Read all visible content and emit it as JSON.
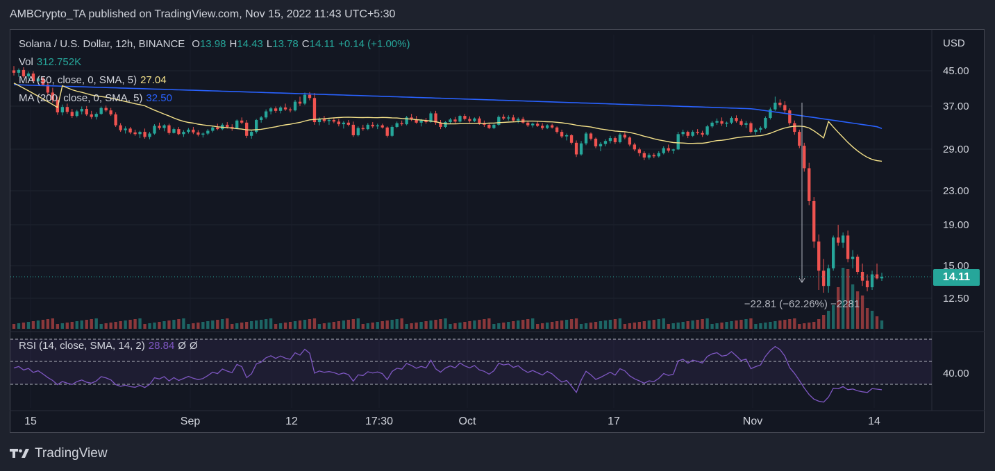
{
  "header": {
    "published": "AMBCrypto_TA published on TradingView.com, Nov 15, 2022 11:43 UTC+5:30"
  },
  "legend": {
    "symbol": "Solana / U.S. Dollar, 12h, BINANCE",
    "o_label": "O",
    "o": "13.98",
    "h_label": "H",
    "h": "14.43",
    "l_label": "L",
    "l": "13.78",
    "c_label": "C",
    "c": "14.11",
    "change": "+0.14 (+1.00%)",
    "vol_label": "Vol",
    "vol": "312.752K",
    "ma50_label": "MA (50, close, 0, SMA, 5)",
    "ma50": "27.04",
    "ma200_label": "MA (200, close, 0, SMA, 5)",
    "ma200": "32.50",
    "rsi_label": "RSI (14, close, SMA, 14, 2)",
    "rsi": "28.84",
    "rsi_extra1": "Ø",
    "rsi_extra2": "Ø"
  },
  "price_axis": {
    "currency": "USD",
    "ticks": [
      "45.00",
      "37.00",
      "29.00",
      "23.00",
      "19.00",
      "15.00",
      "12.50"
    ],
    "last_price": "14.11"
  },
  "rsi_axis": {
    "ticks": [
      "40.00"
    ]
  },
  "time_axis": {
    "ticks": [
      "15",
      "Sep",
      "12",
      "17:30",
      "Oct",
      "17",
      "Nov",
      "14"
    ]
  },
  "measure": {
    "label": "−22.81 (−62.26%) −2281"
  },
  "footer": {
    "brand": "TradingView"
  },
  "colors": {
    "up": "#26a69a",
    "down": "#ef5350",
    "ma50": "#f5e28a",
    "ma200": "#2962ff",
    "rsi": "#7e57c2",
    "background": "#131722"
  },
  "chart_data": {
    "type": "candlestick",
    "timeframe": "12h",
    "price_scale": "log",
    "ylim": [
      11.5,
      50
    ],
    "rsi_ylim": [
      0,
      100
    ],
    "rsi_bands": [
      70,
      50,
      30
    ],
    "candles": [
      [
        45.1,
        46.2,
        43.8,
        44.5
      ],
      [
        44.5,
        45.6,
        43.5,
        45.2
      ],
      [
        45.2,
        45.9,
        43.2,
        43.6
      ],
      [
        43.6,
        44.8,
        42.9,
        44.3
      ],
      [
        44.3,
        44.9,
        42.1,
        42.4
      ],
      [
        42.4,
        43.5,
        41.9,
        43.1
      ],
      [
        43.1,
        43.6,
        41.3,
        41.6
      ],
      [
        41.6,
        42.3,
        39.2,
        39.8
      ],
      [
        39.8,
        40.9,
        37.6,
        38.2
      ],
      [
        38.2,
        38.9,
        35.1,
        35.6
      ],
      [
        35.6,
        37.2,
        35.0,
        36.7
      ],
      [
        36.7,
        37.4,
        35.3,
        35.7
      ],
      [
        35.7,
        36.3,
        34.5,
        34.9
      ],
      [
        34.9,
        36.1,
        34.6,
        35.8
      ],
      [
        35.8,
        36.8,
        35.2,
        36.3
      ],
      [
        36.3,
        36.9,
        34.9,
        35.2
      ],
      [
        35.2,
        35.9,
        34.3,
        34.7
      ],
      [
        34.7,
        35.6,
        34.2,
        35.3
      ],
      [
        35.3,
        36.8,
        35.1,
        36.5
      ],
      [
        36.5,
        37.0,
        35.7,
        36.0
      ],
      [
        36.0,
        36.5,
        34.9,
        35.2
      ],
      [
        35.2,
        35.6,
        32.8,
        33.1
      ],
      [
        33.1,
        33.5,
        31.9,
        32.2
      ],
      [
        32.2,
        32.9,
        31.6,
        32.5
      ],
      [
        32.5,
        32.8,
        31.5,
        31.8
      ],
      [
        31.8,
        32.3,
        31.2,
        31.5
      ],
      [
        31.5,
        32.1,
        30.8,
        31.9
      ],
      [
        31.9,
        32.5,
        30.7,
        31.0
      ],
      [
        31.0,
        31.9,
        30.6,
        31.6
      ],
      [
        31.6,
        33.3,
        31.4,
        33.0
      ],
      [
        33.0,
        33.6,
        32.3,
        32.6
      ],
      [
        32.6,
        33.3,
        32.0,
        33.1
      ],
      [
        33.1,
        33.4,
        31.4,
        31.7
      ],
      [
        31.7,
        32.7,
        31.6,
        32.4
      ],
      [
        32.4,
        32.8,
        31.3,
        31.5
      ],
      [
        31.5,
        32.2,
        31.0,
        31.9
      ],
      [
        31.9,
        32.6,
        31.6,
        32.3
      ],
      [
        32.3,
        32.8,
        31.5,
        31.8
      ],
      [
        31.8,
        32.2,
        31.1,
        31.4
      ],
      [
        31.4,
        31.8,
        30.9,
        31.6
      ],
      [
        31.6,
        32.4,
        31.3,
        32.1
      ],
      [
        32.1,
        32.9,
        31.8,
        32.7
      ],
      [
        32.7,
        33.4,
        32.2,
        32.4
      ],
      [
        32.4,
        33.5,
        32.2,
        33.2
      ],
      [
        33.2,
        33.7,
        32.5,
        32.8
      ],
      [
        32.8,
        33.3,
        32.1,
        32.5
      ],
      [
        32.5,
        34.2,
        32.4,
        34.0
      ],
      [
        34.0,
        34.6,
        33.3,
        33.6
      ],
      [
        33.6,
        34.1,
        30.8,
        31.2
      ],
      [
        31.2,
        32.1,
        30.7,
        31.9
      ],
      [
        31.9,
        34.3,
        31.6,
        34.1
      ],
      [
        34.1,
        34.9,
        33.6,
        34.6
      ],
      [
        34.6,
        36.2,
        34.3,
        35.8
      ],
      [
        35.8,
        36.7,
        35.2,
        36.4
      ],
      [
        36.4,
        36.8,
        35.5,
        35.9
      ],
      [
        35.9,
        36.9,
        35.4,
        36.6
      ],
      [
        36.6,
        37.4,
        35.9,
        36.2
      ],
      [
        36.2,
        36.6,
        35.6,
        36.0
      ],
      [
        36.0,
        38.2,
        35.8,
        37.8
      ],
      [
        37.8,
        38.9,
        36.9,
        37.4
      ],
      [
        37.4,
        39.8,
        37.1,
        39.3
      ],
      [
        39.3,
        39.9,
        38.1,
        38.6
      ],
      [
        38.6,
        39.7,
        33.2,
        33.7
      ],
      [
        33.7,
        34.6,
        33.1,
        34.3
      ],
      [
        34.3,
        34.9,
        33.6,
        33.9
      ],
      [
        33.9,
        34.5,
        33.2,
        34.1
      ],
      [
        34.1,
        34.6,
        33.5,
        33.8
      ],
      [
        33.8,
        34.3,
        32.9,
        33.3
      ],
      [
        33.3,
        33.9,
        32.5,
        33.6
      ],
      [
        33.6,
        34.1,
        32.9,
        33.2
      ],
      [
        33.2,
        33.8,
        31.0,
        31.3
      ],
      [
        31.3,
        32.9,
        31.1,
        32.6
      ],
      [
        32.6,
        33.2,
        32.1,
        32.4
      ],
      [
        32.4,
        33.5,
        32.2,
        33.2
      ],
      [
        33.2,
        33.7,
        32.6,
        32.9
      ],
      [
        32.9,
        33.4,
        32.4,
        33.1
      ],
      [
        33.1,
        33.4,
        32.5,
        32.7
      ],
      [
        32.7,
        32.9,
        30.9,
        31.2
      ],
      [
        31.2,
        33.1,
        31.0,
        32.8
      ],
      [
        32.8,
        33.8,
        32.6,
        33.5
      ],
      [
        33.5,
        34.0,
        33.0,
        33.3
      ],
      [
        33.3,
        34.9,
        33.1,
        34.6
      ],
      [
        34.6,
        35.3,
        33.9,
        34.2
      ],
      [
        34.2,
        34.9,
        33.4,
        33.6
      ],
      [
        33.6,
        34.3,
        32.9,
        34.0
      ],
      [
        34.0,
        34.5,
        33.4,
        33.7
      ],
      [
        33.7,
        35.8,
        33.6,
        35.4
      ],
      [
        35.4,
        35.9,
        33.2,
        33.6
      ],
      [
        33.6,
        34.1,
        32.4,
        32.8
      ],
      [
        32.8,
        33.9,
        32.6,
        33.7
      ],
      [
        33.7,
        34.5,
        33.4,
        34.2
      ],
      [
        34.2,
        34.7,
        33.5,
        33.8
      ],
      [
        33.8,
        35.1,
        33.6,
        34.9
      ],
      [
        34.9,
        35.3,
        34.0,
        34.3
      ],
      [
        34.3,
        34.8,
        33.6,
        33.9
      ],
      [
        33.9,
        34.6,
        33.7,
        34.4
      ],
      [
        34.4,
        34.8,
        33.2,
        33.5
      ],
      [
        33.5,
        34.0,
        32.8,
        33.2
      ],
      [
        33.2,
        33.5,
        32.4,
        32.6
      ],
      [
        32.6,
        33.4,
        32.4,
        33.2
      ],
      [
        33.2,
        35.0,
        33.0,
        34.7
      ],
      [
        34.7,
        35.2,
        34.1,
        34.4
      ],
      [
        34.4,
        35.0,
        34.0,
        34.6
      ],
      [
        34.6,
        35.1,
        33.7,
        34.0
      ],
      [
        34.0,
        34.6,
        33.5,
        34.3
      ],
      [
        34.3,
        34.7,
        33.4,
        33.6
      ],
      [
        33.6,
        33.9,
        32.8,
        33.1
      ],
      [
        33.1,
        33.6,
        32.7,
        33.4
      ],
      [
        33.4,
        33.8,
        32.8,
        33.0
      ],
      [
        33.0,
        33.5,
        32.3,
        32.6
      ],
      [
        32.6,
        33.3,
        32.4,
        33.1
      ],
      [
        33.1,
        33.4,
        32.5,
        32.7
      ],
      [
        32.7,
        32.9,
        31.6,
        31.9
      ],
      [
        31.9,
        32.3,
        30.8,
        31.1
      ],
      [
        31.1,
        31.6,
        30.4,
        31.3
      ],
      [
        31.3,
        31.5,
        29.7,
        30.0
      ],
      [
        30.0,
        30.4,
        27.7,
        28.1
      ],
      [
        28.1,
        30.3,
        27.9,
        29.9
      ],
      [
        29.9,
        31.9,
        29.6,
        31.6
      ],
      [
        31.6,
        31.8,
        30.4,
        30.7
      ],
      [
        30.7,
        30.9,
        29.1,
        29.4
      ],
      [
        29.4,
        30.1,
        28.6,
        29.8
      ],
      [
        29.8,
        30.6,
        29.4,
        30.3
      ],
      [
        30.3,
        31.2,
        29.9,
        30.8
      ],
      [
        30.8,
        31.1,
        29.8,
        30.1
      ],
      [
        30.1,
        31.7,
        29.9,
        31.4
      ],
      [
        31.4,
        31.8,
        30.6,
        30.9
      ],
      [
        30.9,
        31.1,
        29.4,
        29.7
      ],
      [
        29.7,
        30.0,
        28.6,
        28.9
      ],
      [
        28.9,
        29.2,
        27.8,
        28.3
      ],
      [
        28.3,
        28.6,
        27.2,
        27.6
      ],
      [
        27.6,
        28.3,
        27.3,
        28.0
      ],
      [
        28.0,
        28.3,
        27.5,
        27.8
      ],
      [
        27.8,
        28.6,
        27.6,
        28.3
      ],
      [
        28.3,
        29.4,
        28.1,
        29.1
      ],
      [
        29.1,
        29.7,
        28.4,
        28.7
      ],
      [
        28.7,
        29.0,
        28.2,
        28.9
      ],
      [
        28.9,
        31.9,
        28.8,
        31.5
      ],
      [
        31.5,
        32.3,
        31.1,
        31.9
      ],
      [
        31.9,
        32.1,
        30.8,
        31.2
      ],
      [
        31.2,
        32.2,
        31.0,
        31.9
      ],
      [
        31.9,
        32.4,
        31.4,
        31.7
      ],
      [
        31.7,
        32.1,
        31.0,
        31.4
      ],
      [
        31.4,
        33.2,
        31.2,
        32.9
      ],
      [
        32.9,
        33.9,
        32.6,
        33.6
      ],
      [
        33.6,
        34.4,
        33.2,
        33.9
      ],
      [
        33.9,
        34.6,
        33.0,
        33.4
      ],
      [
        33.4,
        33.8,
        32.8,
        33.6
      ],
      [
        33.6,
        34.8,
        33.3,
        34.5
      ],
      [
        34.5,
        35.0,
        33.6,
        33.9
      ],
      [
        33.9,
        34.3,
        32.9,
        33.2
      ],
      [
        33.2,
        33.9,
        32.6,
        33.5
      ],
      [
        33.5,
        33.8,
        31.6,
        31.9
      ],
      [
        31.9,
        32.6,
        31.4,
        32.3
      ],
      [
        32.3,
        32.9,
        31.8,
        32.6
      ],
      [
        32.6,
        34.8,
        32.4,
        34.5
      ],
      [
        34.5,
        36.6,
        34.2,
        36.2
      ],
      [
        36.2,
        38.9,
        35.9,
        37.6
      ],
      [
        37.6,
        38.3,
        36.6,
        37.1
      ],
      [
        37.1,
        37.9,
        35.4,
        36.0
      ],
      [
        36.0,
        36.4,
        33.1,
        33.5
      ],
      [
        33.5,
        34.0,
        31.4,
        31.9
      ],
      [
        31.9,
        32.3,
        29.1,
        29.5
      ],
      [
        29.5,
        30.0,
        25.5,
        26.0
      ],
      [
        26.0,
        26.8,
        21.1,
        21.6
      ],
      [
        21.6,
        22.1,
        16.6,
        17.2
      ],
      [
        17.2,
        17.9,
        13.1,
        14.6
      ],
      [
        14.6,
        15.6,
        12.9,
        13.4
      ],
      [
        13.4,
        15.1,
        12.9,
        14.8
      ],
      [
        14.8,
        17.8,
        14.6,
        17.6
      ],
      [
        17.6,
        18.9,
        16.8,
        17.1
      ],
      [
        17.1,
        18.1,
        16.6,
        17.8
      ],
      [
        17.8,
        18.3,
        15.3,
        15.6
      ],
      [
        15.6,
        16.4,
        14.8,
        15.8
      ],
      [
        15.8,
        16.0,
        14.3,
        14.5
      ],
      [
        14.5,
        15.2,
        13.4,
        13.8
      ],
      [
        13.8,
        14.3,
        13.0,
        13.3
      ],
      [
        13.3,
        14.6,
        13.1,
        14.3
      ],
      [
        14.3,
        15.2,
        13.9,
        13.98
      ],
      [
        13.98,
        14.43,
        13.78,
        14.11
      ]
    ],
    "volume_spike": "last ~14 bars",
    "ma50_end": 27.04,
    "ma200_end": 32.5,
    "rsi_last": 28.84,
    "measure_from": 37.6,
    "measure_to": 14.1
  }
}
